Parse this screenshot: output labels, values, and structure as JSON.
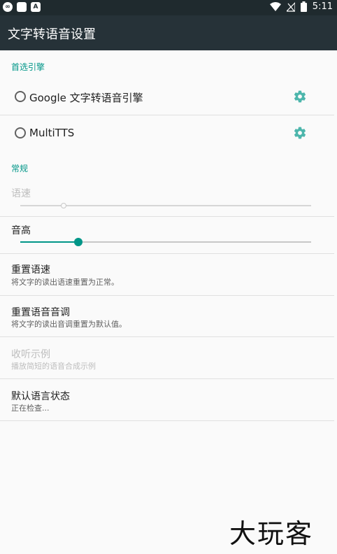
{
  "status_bar": {
    "time": "5:11",
    "icons": [
      "infinity-icon",
      "blank-app-icon",
      "a-icon",
      "wifi-icon",
      "signal-off-icon",
      "battery-icon"
    ]
  },
  "app_bar": {
    "title": "文字转语音设置"
  },
  "preferred_engine": {
    "header": "首选引擎",
    "engines": [
      {
        "label": "Google 文字转语音引擎",
        "selected": false
      },
      {
        "label": "MultiTTS",
        "selected": false
      }
    ]
  },
  "general": {
    "header": "常规",
    "speech_rate": {
      "label": "语速",
      "enabled": false,
      "value": 0.15
    },
    "pitch": {
      "label": "音高",
      "enabled": true,
      "value": 0.2
    },
    "reset_rate": {
      "title": "重置语速",
      "summary": "将文字的读出语速重置为正常。"
    },
    "reset_pitch": {
      "title": "重置语音音调",
      "summary": "将文字的读出音调重置为默认值。"
    },
    "listen_example": {
      "title": "收听示例",
      "summary": "播放简短的语音合成示例",
      "enabled": false
    },
    "default_language": {
      "title": "默认语言状态",
      "summary": "正在检查..."
    }
  },
  "watermark": "大玩客",
  "colors": {
    "accent": "#009688",
    "app_bar": "#263238",
    "status_bar": "#1f2a2e"
  }
}
